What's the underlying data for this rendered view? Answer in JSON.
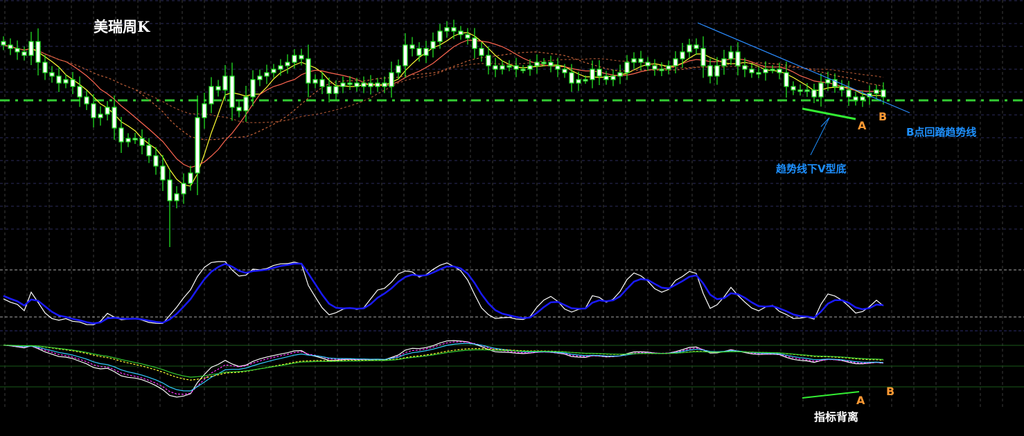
{
  "chart_data": {
    "type": "candlestick",
    "title": "美瑞周K",
    "period": "weekly",
    "price_units": "relative",
    "closes": [
      295,
      290,
      285,
      280,
      300,
      270,
      255,
      250,
      240,
      245,
      235,
      220,
      210,
      190,
      195,
      205,
      175,
      155,
      160,
      160,
      150,
      135,
      120,
      100,
      70,
      80,
      95,
      110,
      190,
      210,
      235,
      230,
      250,
      205,
      200,
      220,
      245,
      250,
      255,
      260,
      265,
      270,
      280,
      275,
      240,
      245,
      235,
      225,
      235,
      240,
      240,
      235,
      240,
      235,
      240,
      235,
      255,
      265,
      295,
      290,
      280,
      290,
      300,
      315,
      320,
      315,
      310,
      305,
      290,
      280,
      265,
      260,
      265,
      265,
      260,
      260,
      265,
      270,
      270,
      265,
      260,
      255,
      240,
      245,
      245,
      260,
      250,
      245,
      250,
      255,
      270,
      275,
      270,
      265,
      260,
      260,
      265,
      275,
      285,
      295,
      290,
      265,
      250,
      265,
      275,
      285,
      265,
      260,
      255,
      255,
      260,
      260,
      255,
      235,
      230,
      230,
      230,
      220,
      240,
      245,
      235,
      230,
      220,
      215,
      220,
      225,
      230,
      220
    ],
    "ylim": [
      0,
      360
    ],
    "support_level": 215,
    "moving_averages": [
      {
        "name": "MA5",
        "period": 5,
        "color": "#ffff33",
        "style": "solid"
      },
      {
        "name": "MA10",
        "period": 10,
        "color": "#ff6650",
        "style": "solid"
      },
      {
        "name": "MA20",
        "period": 20,
        "color": "#c8643a",
        "style": "dashed"
      },
      {
        "name": "MA30",
        "period": 30,
        "color": "#a05030",
        "style": "dashed"
      }
    ],
    "trendline": {
      "from": {
        "index": 100,
        "price": 327
      },
      "to": {
        "index": 131,
        "price": 197
      },
      "color": "#2a8cff"
    },
    "stochastic": {
      "period": 9,
      "upper": 80,
      "lower": 20,
      "k_color": "#ffffff",
      "d_color": "#1a1aff"
    },
    "indicator_lines": [
      {
        "ema": 3,
        "color": "#ffffff",
        "style": "solid"
      },
      {
        "ema": 5,
        "color": "#ff33ff",
        "style": "dashed"
      },
      {
        "ema": 8,
        "color": "#33ccff",
        "style": "solid"
      },
      {
        "ema": 20,
        "color": "#ffff33",
        "style": "dashed"
      },
      {
        "ema": 24,
        "color": "#33cc33",
        "style": "solid"
      }
    ],
    "colors": {
      "candle_body": "#ffffff",
      "candle_edge": "#22dd22",
      "support": "#33cc33",
      "annotation_blue": "#1e90ff",
      "annotation_orange": "#ff9933"
    }
  },
  "annotations": {
    "point_a": "A",
    "point_b": "B",
    "b_retest": "B点回踏趋势线",
    "v_bottom": "趋势线下V型底",
    "ind_a": "A",
    "ind_b": "B",
    "divergence": "指标背离"
  }
}
